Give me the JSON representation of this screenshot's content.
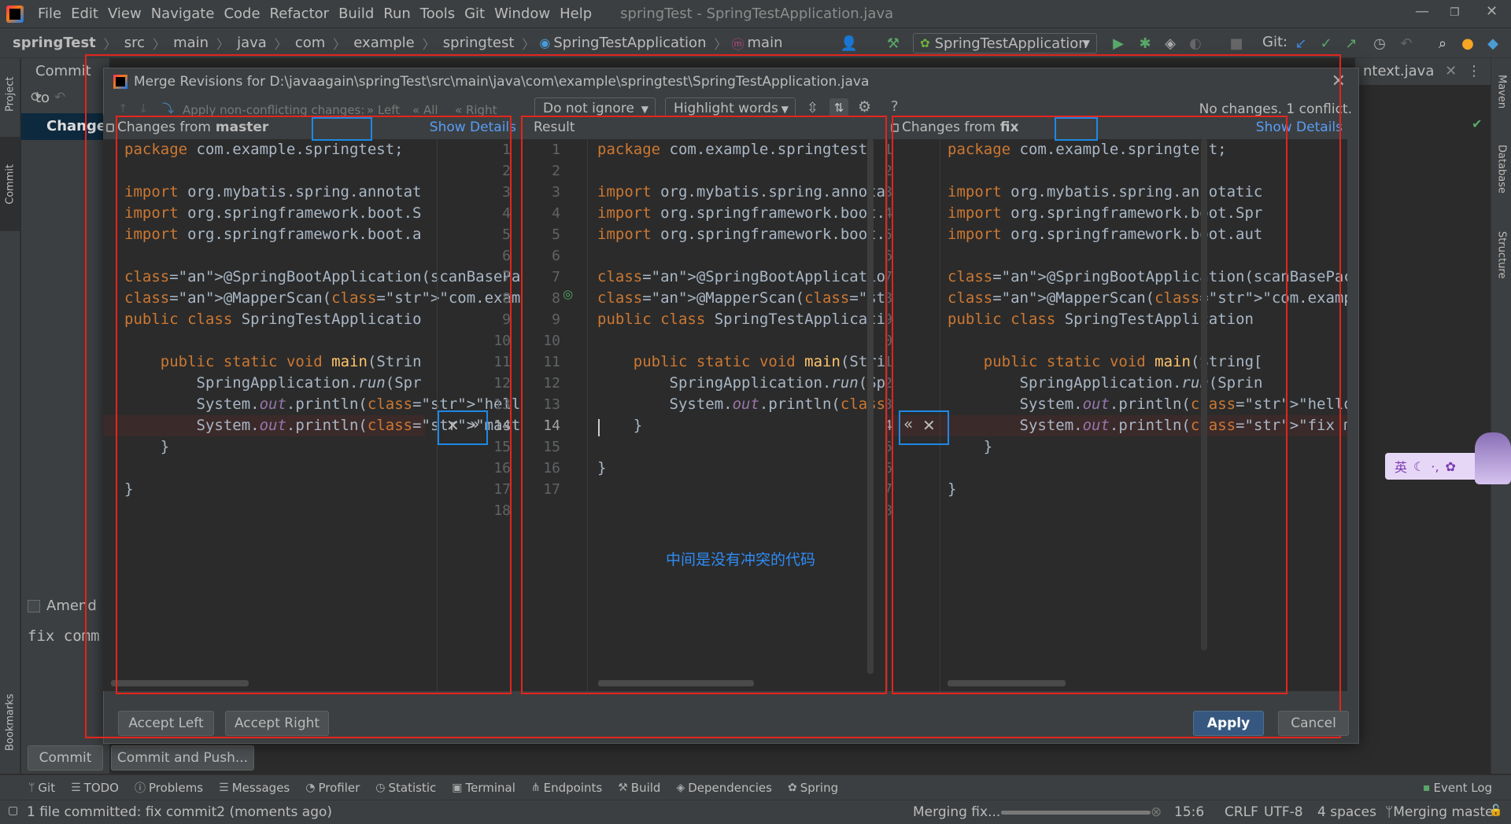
{
  "menubar": {
    "items": [
      "File",
      "Edit",
      "View",
      "Navigate",
      "Code",
      "Refactor",
      "Build",
      "Run",
      "Tools",
      "Git",
      "Window",
      "Help"
    ],
    "window_title": "springTest - SpringTestApplication.java"
  },
  "navbar": {
    "breadcrumbs": [
      "springTest",
      "src",
      "main",
      "java",
      "com",
      "example",
      "springtest",
      "SpringTestApplication",
      "main"
    ],
    "run_config": "SpringTestApplication",
    "git_label": "Git:"
  },
  "left_strip": {
    "project": "Project",
    "commit": "Commit",
    "bookmarks": "Bookmarks"
  },
  "right_strip": {
    "maven": "Maven",
    "database": "Database",
    "structure": "Structure"
  },
  "commit_panel": {
    "header": "Commit to",
    "changes": "Changes",
    "amend": "Amend",
    "message": "fix comm",
    "commit_button": "Commit",
    "commit_push_button": "Commit and Push..."
  },
  "editor_tab": "ntext.java",
  "dialog": {
    "title": "Merge Revisions for D:\\javaagain\\springTest\\src\\main\\java\\com\\example\\springtest\\SpringTestApplication.java",
    "toolbar": {
      "apply_nonconflicting": "Apply non-conflicting changes:",
      "left": "Left",
      "all": "All",
      "right": "Right",
      "ignore_dropdown": "Do not ignore",
      "highlight_dropdown": "Highlight words",
      "status": "No changes. 1 conflict."
    },
    "left_pane": {
      "header_prefix": "Changes from",
      "branch": "master",
      "show_details": "Show Details",
      "line_numbers": [
        "1",
        "2",
        "3",
        "4",
        "5",
        "6",
        "7",
        "8",
        "9",
        "10",
        "11",
        "12",
        "13",
        "14",
        "15",
        "16",
        "17",
        "18"
      ]
    },
    "center_pane": {
      "header": "Result",
      "line_numbers": [
        "1",
        "2",
        "3",
        "4",
        "5",
        "6",
        "7",
        "8",
        "9",
        "10",
        "11",
        "12",
        "13",
        "14",
        "15",
        "16",
        "17"
      ],
      "annotation": "中间是没有冲突的代码"
    },
    "right_pane": {
      "header_prefix": "Changes from",
      "branch": "fix",
      "show_details": "Show Details"
    },
    "buttons": {
      "accept_left": "Accept Left",
      "accept_right": "Accept Right",
      "apply": "Apply",
      "cancel": "Cancel"
    }
  },
  "code": {
    "left": [
      "package com.example.springtest;",
      "",
      "import org.mybatis.spring.annotat",
      "import org.springframework.boot.S",
      "import org.springframework.boot.a",
      "",
      "@SpringBootApplication(scanBasePa",
      "@MapperScan(\"com.example.mapper\")",
      "public class SpringTestApplicatio",
      "",
      "    public static void main(Strin",
      "        SpringApplication.run(Spr",
      "        System.out.println(\"hello",
      "        System.out.println(\"maste",
      "    }",
      "",
      "}",
      ""
    ],
    "center": [
      "package com.example.springtest;",
      "",
      "import org.mybatis.spring.annotation",
      "import org.springframework.boot.Spri",
      "import org.springframework.boot.auto",
      "",
      "@SpringBootApplication(scanBasePacka",
      "@MapperScan(\"com.example.mapper\")",
      "public class SpringTestApplication {",
      "",
      "    public static void main(String[]",
      "        SpringApplication.run(Spring",
      "        System.out.println(\"hello\");",
      "    }",
      "",
      "}",
      ""
    ],
    "right": [
      "package com.example.springtest;",
      "",
      "import org.mybatis.spring.annotatic",
      "import org.springframework.boot.Spr",
      "import org.springframework.boot.aut",
      "",
      "@SpringBootApplication(scanBasePack",
      "@MapperScan(\"com.example.mapper\")",
      "public class SpringTestApplication",
      "",
      "    public static void main(String[",
      "        SpringApplication.run(Sprin",
      "        System.out.println(\"hello\")",
      "        System.out.println(\"fix mod",
      "    }",
      "",
      "}",
      ""
    ]
  },
  "tool_windows": [
    "Git",
    "TODO",
    "Problems",
    "Messages",
    "Profiler",
    "Statistic",
    "Terminal",
    "Endpoints",
    "Build",
    "Dependencies",
    "Spring"
  ],
  "event_log": "Event Log",
  "statusbar": {
    "message": "1 file committed: fix commit2 (moments ago)",
    "task": "Merging fix...",
    "position": "15:6",
    "line_sep": "CRLF",
    "encoding": "UTF-8",
    "indent": "4 spaces",
    "branch": "Merging master"
  },
  "ime": {
    "label": "英"
  },
  "colors": {
    "highlight_red": "#e3251d",
    "highlight_blue": "#1e88e5",
    "accent": "#365880"
  }
}
